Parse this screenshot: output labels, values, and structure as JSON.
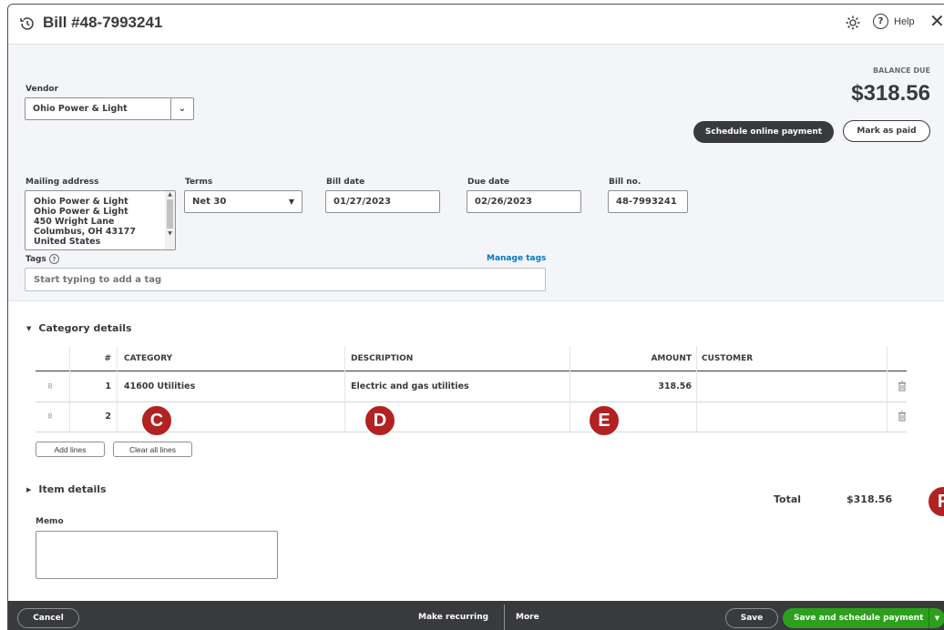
{
  "header": {
    "title": "Bill #48-7993241",
    "help_label": "Help"
  },
  "vendor": {
    "label": "Vendor",
    "value": "Ohio Power & Light"
  },
  "balance": {
    "label": "BALANCE DUE",
    "amount": "$318.56",
    "schedule_label": "Schedule online payment",
    "mark_paid_label": "Mark as paid"
  },
  "mailing": {
    "label": "Mailing address",
    "lines": [
      "Ohio Power & Light",
      "Ohio Power & Light",
      "450 Wright Lane",
      "Columbus, OH  43177",
      "United States"
    ]
  },
  "terms": {
    "label": "Terms",
    "value": "Net 30"
  },
  "bill_date": {
    "label": "Bill date",
    "value": "01/27/2023"
  },
  "due_date": {
    "label": "Due date",
    "value": "02/26/2023"
  },
  "bill_no": {
    "label": "Bill no.",
    "value": "48-7993241"
  },
  "tags": {
    "label": "Tags",
    "manage_label": "Manage tags",
    "placeholder": "Start typing to add a tag"
  },
  "category": {
    "section_label": "Category details",
    "columns": [
      "#",
      "CATEGORY",
      "DESCRIPTION",
      "AMOUNT",
      "CUSTOMER"
    ],
    "rows": [
      {
        "num": "1",
        "category": "41600 Utilities",
        "description": "Electric and gas utilities",
        "amount": "318.56",
        "customer": ""
      },
      {
        "num": "2",
        "category": "",
        "description": "",
        "amount": "",
        "customer": ""
      }
    ],
    "add_lines_label": "Add lines",
    "clear_lines_label": "Clear all lines"
  },
  "items": {
    "section_label": "Item details"
  },
  "total": {
    "label": "Total",
    "value": "$318.56"
  },
  "memo": {
    "label": "Memo"
  },
  "callouts": {
    "c": "C",
    "d": "D",
    "e": "E",
    "f": "F"
  },
  "footer": {
    "cancel_label": "Cancel",
    "recurring_label": "Make recurring",
    "more_label": "More",
    "save_label": "Save",
    "save_schedule_label": "Save and schedule payment"
  },
  "colors": {
    "accent_green": "#2ca01c",
    "link_blue": "#0077c5",
    "callout_red": "#b22222",
    "dark": "#393a3d"
  }
}
